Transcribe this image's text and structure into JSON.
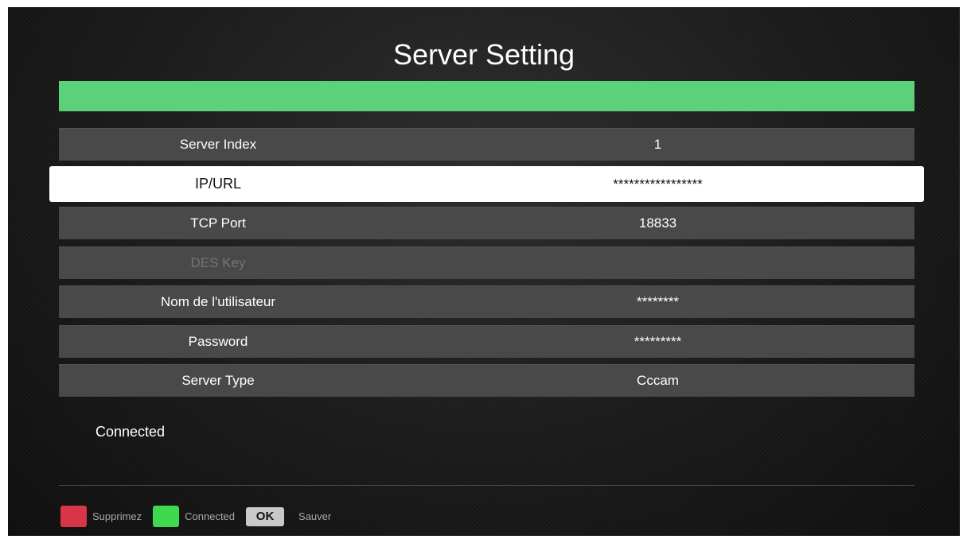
{
  "title": "Server Setting",
  "progress": {
    "percent": 100,
    "color": "#5bd27a"
  },
  "rows": [
    {
      "label": "Server Index",
      "value": "1",
      "state": "normal"
    },
    {
      "label": "IP/URL",
      "value": "*****************",
      "state": "selected"
    },
    {
      "label": "TCP Port",
      "value": "18833",
      "state": "normal"
    },
    {
      "label": "DES Key",
      "value": "",
      "state": "disabled"
    },
    {
      "label": "Nom de l'utilisateur",
      "value": "********",
      "state": "normal"
    },
    {
      "label": "Password",
      "value": "*********",
      "state": "normal"
    },
    {
      "label": "Server Type",
      "value": "Cccam",
      "state": "normal"
    }
  ],
  "status": "Connected",
  "footer": {
    "red_label": "Supprimez",
    "green_label": "Connected",
    "ok_key": "OK",
    "ok_label": "Sauver",
    "red_color": "#d83648",
    "green_color": "#3fd94f"
  }
}
